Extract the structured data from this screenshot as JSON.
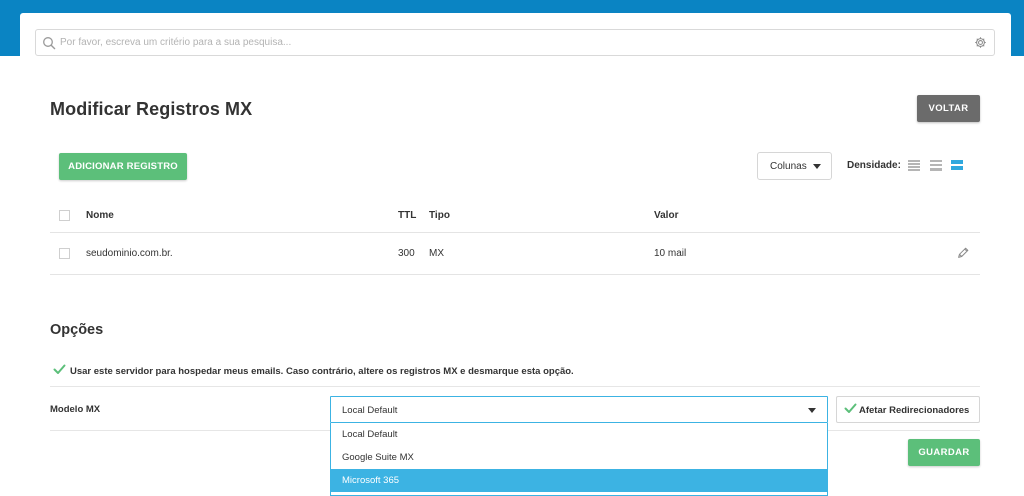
{
  "colors": {
    "header_blue": "#0a84c3",
    "primary_green": "#5cbf7a",
    "neutral_button": "#6b6b6b",
    "select_accent": "#3cb3e3"
  },
  "search": {
    "placeholder": "Por favor, escreva um critério para a sua pesquisa...",
    "icon": "search-icon",
    "settings_icon": "gear-icon"
  },
  "page": {
    "title": "Modificar Registros MX",
    "back_button": "VOLTAR"
  },
  "toolbar": {
    "add_record": "ADICIONAR REGISTRO",
    "columns": "Colunas",
    "density_label": "Densidade:",
    "density_options": [
      "compact",
      "normal",
      "comfortable"
    ],
    "density_selected": "comfortable"
  },
  "table": {
    "columns": [
      "Nome",
      "TTL",
      "Tipo",
      "Valor"
    ],
    "rows": [
      {
        "nome": "seudominio.com.br.",
        "ttl": "300",
        "tipo": "MX",
        "valor": "10 mail",
        "action_icon": "pencil-icon"
      }
    ]
  },
  "options": {
    "title": "Opções",
    "host_emails": {
      "checked": true,
      "label": "Usar este servidor para hospedar meus emails. Caso contrário, altere os registros MX e desmarque esta opção."
    },
    "mx_model": {
      "label": "Modelo MX",
      "selected": "Local Default",
      "options": [
        "Local Default",
        "Google Suite MX",
        "Microsoft 365"
      ],
      "highlighted": "Microsoft 365"
    },
    "affect_redirectors": {
      "checked": true,
      "label": "Afetar Redirecionadores"
    },
    "save_button": "GUARDAR"
  }
}
